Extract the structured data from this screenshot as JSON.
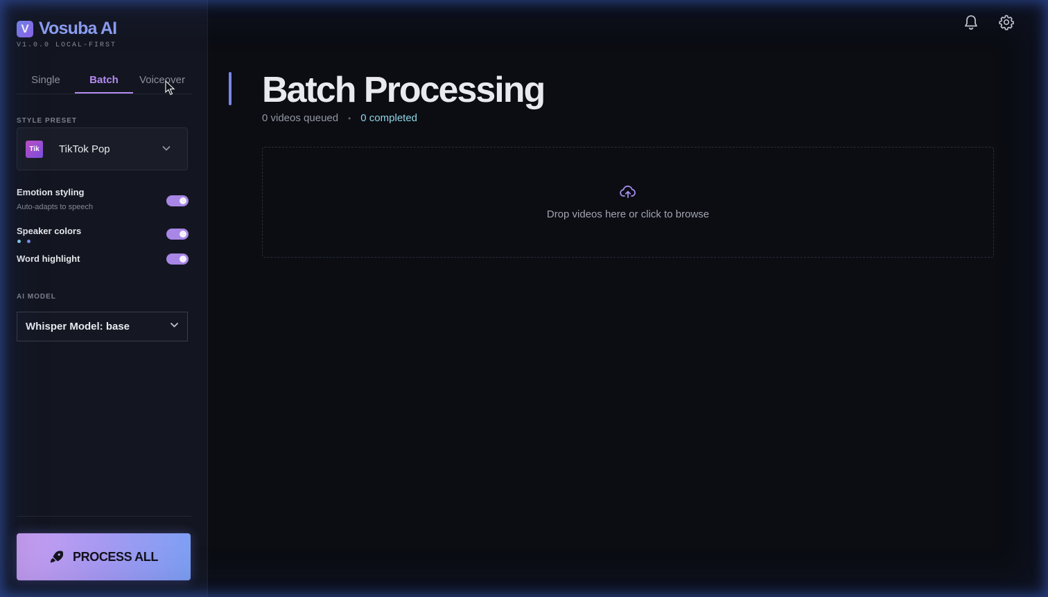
{
  "brand": {
    "logo_letter": "V",
    "name": "Vosuba AI",
    "version": "V1.0.0 LOCAL-FIRST"
  },
  "tabs": [
    {
      "label": "Single",
      "active": false
    },
    {
      "label": "Batch",
      "active": true
    },
    {
      "label": "Voiceover",
      "active": false
    }
  ],
  "style_preset": {
    "section_label": "STYLE PRESET",
    "thumb": "Tik",
    "selected": "TikTok Pop"
  },
  "toggles": {
    "emotion": {
      "label": "Emotion styling",
      "sublabel": "Auto-adapts to speech",
      "on": true
    },
    "speaker": {
      "label": "Speaker colors",
      "on": true,
      "colors": [
        "#7fd0e8",
        "#7e8ef0"
      ]
    },
    "word": {
      "label": "Word highlight",
      "on": true
    }
  },
  "ai_model": {
    "section_label": "AI MODEL",
    "selected": "Whisper Model: base"
  },
  "process_button": {
    "label": "PROCESS ALL",
    "icon": "rocket-icon"
  },
  "header_icons": [
    "bell-icon",
    "gear-icon"
  ],
  "main": {
    "title": "Batch Processing",
    "queued": "0 videos queued",
    "separator": "•",
    "completed": "0 completed",
    "dropzone_text": "Drop videos here or click to browse"
  },
  "colors": {
    "accent": "#b58bf0",
    "completed": "#8fd6e8",
    "toggle_on": "#a886e6"
  }
}
